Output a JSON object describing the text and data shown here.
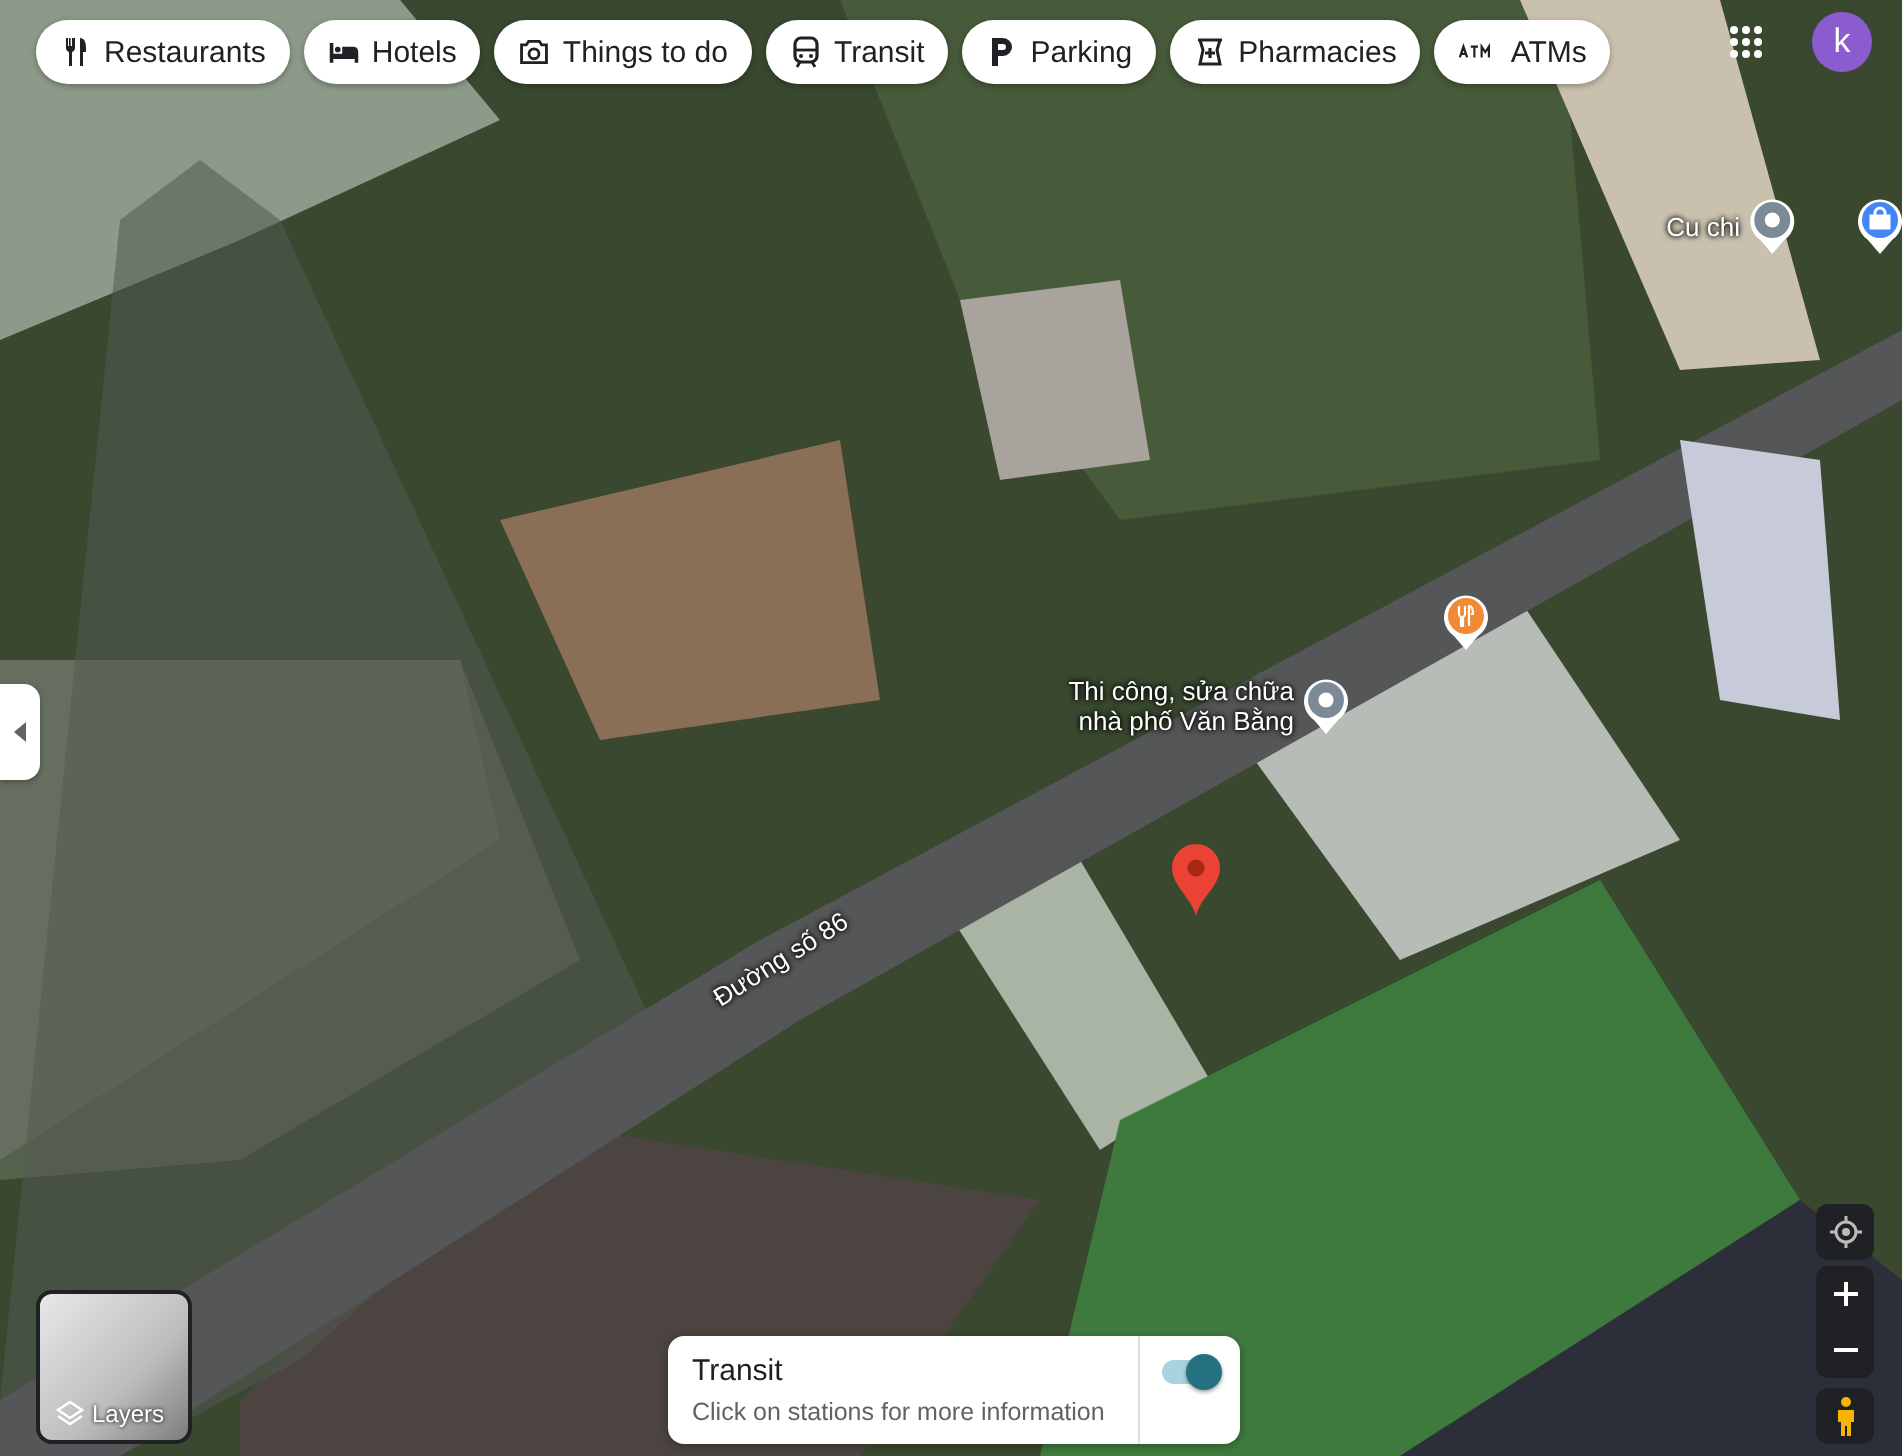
{
  "categories": [
    {
      "label": "Restaurants",
      "kind": "restaurant"
    },
    {
      "label": "Hotels",
      "kind": "hotel"
    },
    {
      "label": "Things to do",
      "kind": "camera"
    },
    {
      "label": "Transit",
      "kind": "transit"
    },
    {
      "label": "Parking",
      "kind": "parking"
    },
    {
      "label": "Pharmacies",
      "kind": "pharmacy"
    },
    {
      "label": "ATMs",
      "kind": "atm"
    }
  ],
  "account": {
    "initial": "k"
  },
  "map": {
    "places": [
      {
        "name": "Cu chi",
        "kind": "place"
      },
      {
        "kind": "shopping"
      },
      {
        "kind": "restaurant"
      },
      {
        "name": "Thi công, sửa chữa nhà phố Văn Bằng",
        "kind": "place"
      },
      {
        "kind": "dropped"
      }
    ],
    "road_label": "Đường số 86"
  },
  "layers": {
    "label": "Layers"
  },
  "transit_card": {
    "title": "Transit",
    "description": "Click on stations for more information",
    "on": true
  }
}
